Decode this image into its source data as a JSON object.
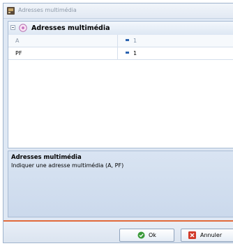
{
  "window": {
    "title": "Adresses multimédia"
  },
  "grid": {
    "category": {
      "label": "Adresses multimédia",
      "expander_icon": "collapse-minus-icon",
      "icon": "category-circle-icon"
    },
    "rows": [
      {
        "name": "A",
        "value": "1",
        "state": "disabled",
        "value_icon": "number-icon"
      },
      {
        "name": "PF",
        "value": "1",
        "state": "enabled",
        "value_icon": "number-icon"
      }
    ]
  },
  "description": {
    "title": "Adresses multimédia",
    "text": "Indiquer une adresse multimédia (A, PF)"
  },
  "buttons": {
    "ok_label": "Ok",
    "ok_icon": "check-circle-icon",
    "cancel_label": "Annuler",
    "cancel_icon": "cancel-x-icon"
  },
  "colors": {
    "accent_separator": "#e26a3a",
    "ok_icon": "#3a9a3a",
    "cancel_icon": "#d23a2a"
  }
}
